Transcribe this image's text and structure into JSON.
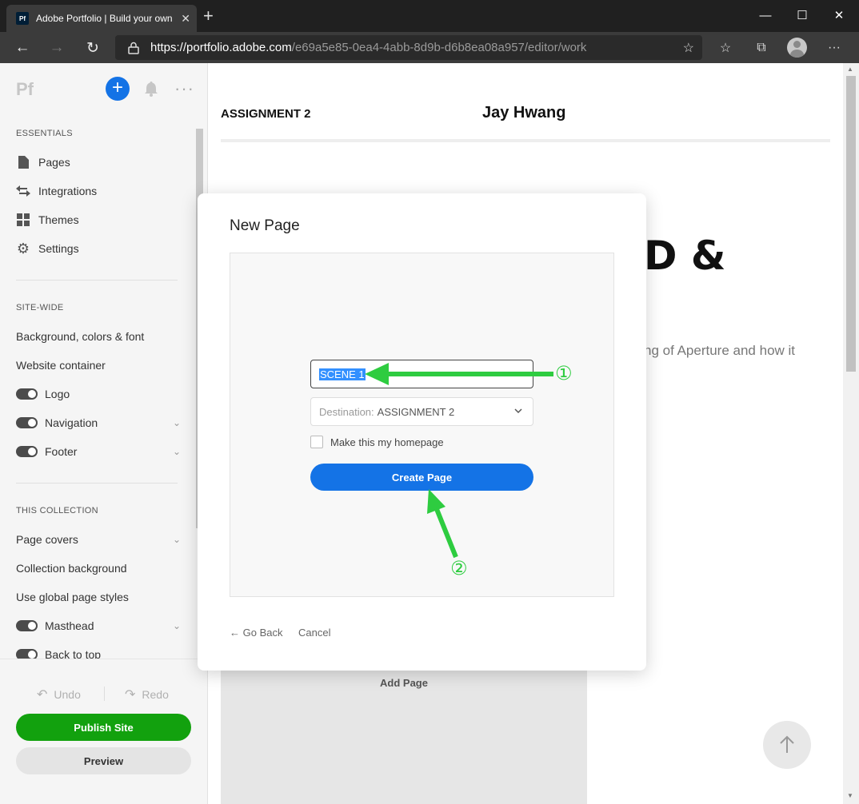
{
  "browser": {
    "tab_title": "Adobe Portfolio | Build your own",
    "favicon_text": "Pf",
    "url_host": "https://portfolio.adobe.com",
    "url_path": "/e69a5e85-0ea4-4abb-8d9b-d6b8ea08a957/editor/work"
  },
  "sidebar": {
    "logo": "Pf",
    "essentials_title": "ESSENTIALS",
    "essentials": [
      {
        "label": "Pages",
        "icon": "page-icon"
      },
      {
        "label": "Integrations",
        "icon": "arrows-icon"
      },
      {
        "label": "Themes",
        "icon": "grid-icon"
      },
      {
        "label": "Settings",
        "icon": "gear-icon"
      }
    ],
    "sitewide_title": "SITE-WIDE",
    "sitewide": [
      {
        "label": "Background, colors & font"
      },
      {
        "label": "Website container"
      },
      {
        "label": "Logo",
        "toggle": true
      },
      {
        "label": "Navigation",
        "toggle": true,
        "expandable": true
      },
      {
        "label": "Footer",
        "toggle": true,
        "expandable": true
      }
    ],
    "collection_title": "THIS COLLECTION",
    "collection": [
      {
        "label": "Page covers",
        "expandable": true
      },
      {
        "label": "Collection background"
      },
      {
        "label": "Use global page styles"
      },
      {
        "label": "Masthead",
        "toggle": true,
        "expandable": true
      },
      {
        "label": "Back to top",
        "toggle": true
      }
    ],
    "undo": "Undo",
    "redo": "Redo",
    "publish": "Publish Site",
    "preview": "Preview"
  },
  "site": {
    "collection_title": "ASSIGNMENT 2",
    "owner_name": "Jay Hwang",
    "hero_fragment": "D &",
    "body_fragment": "ng of Aperture and how it",
    "add_page_label": "Add Page"
  },
  "dialog": {
    "title": "New Page",
    "page_name_value": "SCENE 1",
    "destination_label": "Destination:",
    "destination_value": "ASSIGNMENT 2",
    "homepage_label": "Make this my homepage",
    "homepage_checked": false,
    "create_label": "Create Page",
    "go_back": "← Go Back",
    "cancel": "Cancel"
  },
  "annotations": {
    "step1": "①",
    "step2": "②",
    "color": "#2ecc40"
  },
  "colors": {
    "primary_blue": "#1473e6",
    "publish_green": "#12a10e"
  }
}
